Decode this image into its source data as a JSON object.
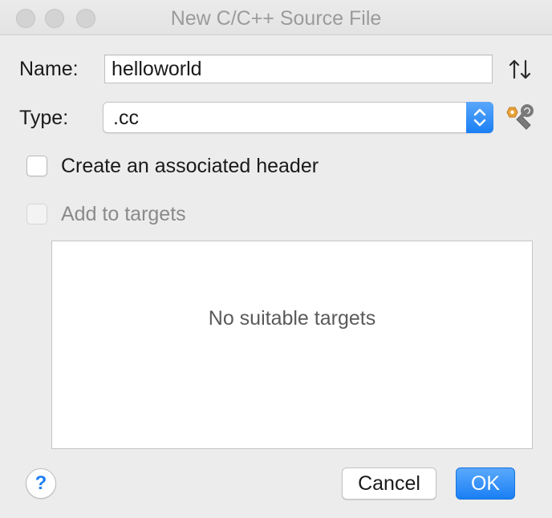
{
  "window": {
    "title": "New C/C++ Source File"
  },
  "form": {
    "name_label": "Name:",
    "name_value": "helloworld",
    "type_label": "Type:",
    "type_value": ".cc"
  },
  "options": {
    "create_header_label": "Create an associated header",
    "create_header_checked": false,
    "add_to_targets_label": "Add to targets",
    "add_to_targets_checked": false,
    "add_to_targets_enabled": false
  },
  "targets": {
    "empty_message": "No suitable targets"
  },
  "footer": {
    "help_label": "?",
    "cancel_label": "Cancel",
    "ok_label": "OK"
  },
  "colors": {
    "accent": "#1a7ff4",
    "window_bg": "#ececec",
    "disabled_text": "#8a8a8a"
  }
}
